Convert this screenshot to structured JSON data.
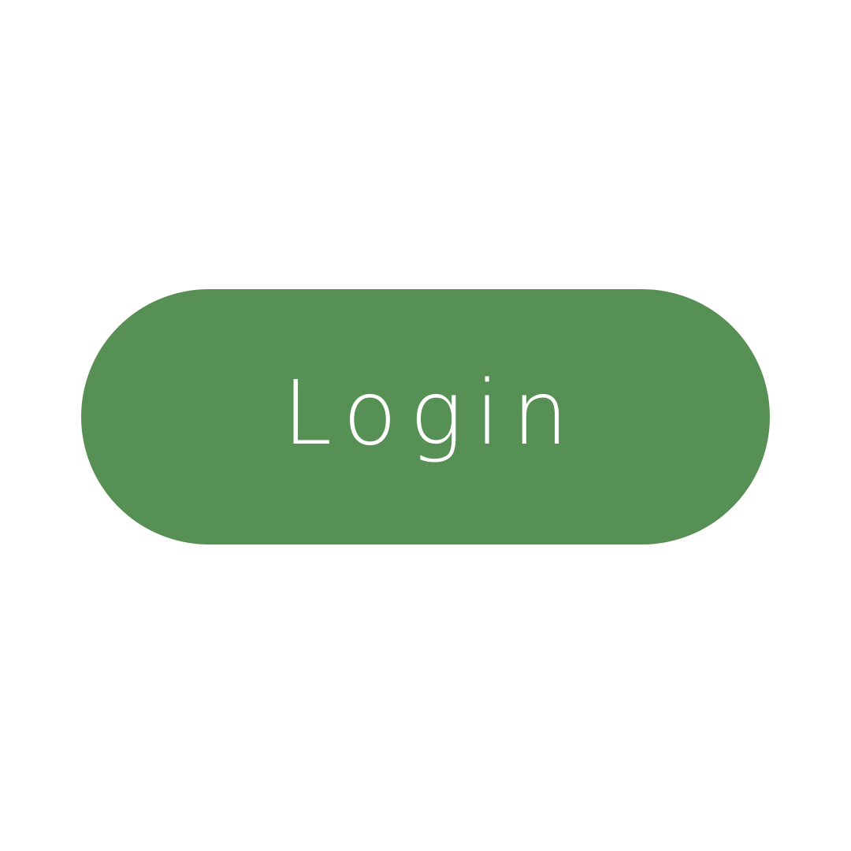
{
  "login_button": {
    "label": "Login",
    "background_color": "#579054",
    "text_color": "#ffffff"
  },
  "page": {
    "background_color": "#ffffff"
  }
}
